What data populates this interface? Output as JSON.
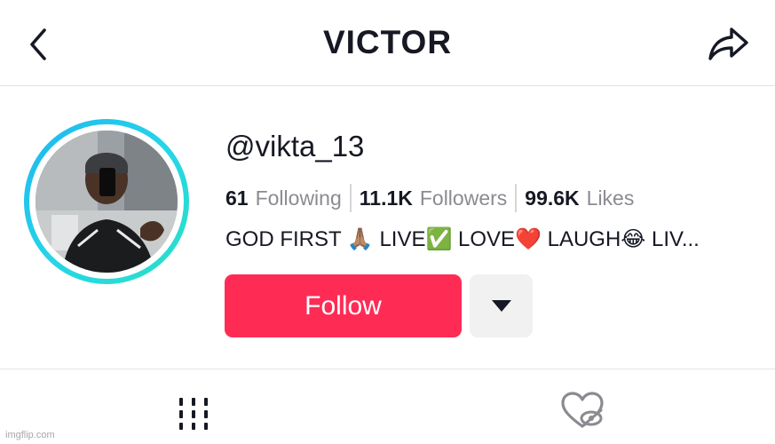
{
  "header": {
    "title": "VICTOR",
    "back_icon": "chevron-left-icon",
    "share_icon": "share-arrow-icon"
  },
  "profile": {
    "handle": "@vikta_13",
    "avatar_ring_colors": [
      "#1fb6ee",
      "#2be0c4"
    ],
    "stats": [
      {
        "value": "61",
        "label": "Following"
      },
      {
        "value": "11.1K",
        "label": "Followers"
      },
      {
        "value": "99.6K",
        "label": "Likes"
      }
    ],
    "bio": "GOD FIRST 🙏🏽 LIVE✅ LOVE❤️ LAUGH😂 LIV..."
  },
  "actions": {
    "follow_label": "Follow",
    "follow_color": "#fe2c55",
    "dropdown_icon": "caret-down-icon"
  },
  "tabs": [
    {
      "name": "videos",
      "icon": "grid-bars-icon"
    },
    {
      "name": "liked",
      "icon": "heart-hidden-icon"
    }
  ],
  "watermark": "imgflip.com"
}
